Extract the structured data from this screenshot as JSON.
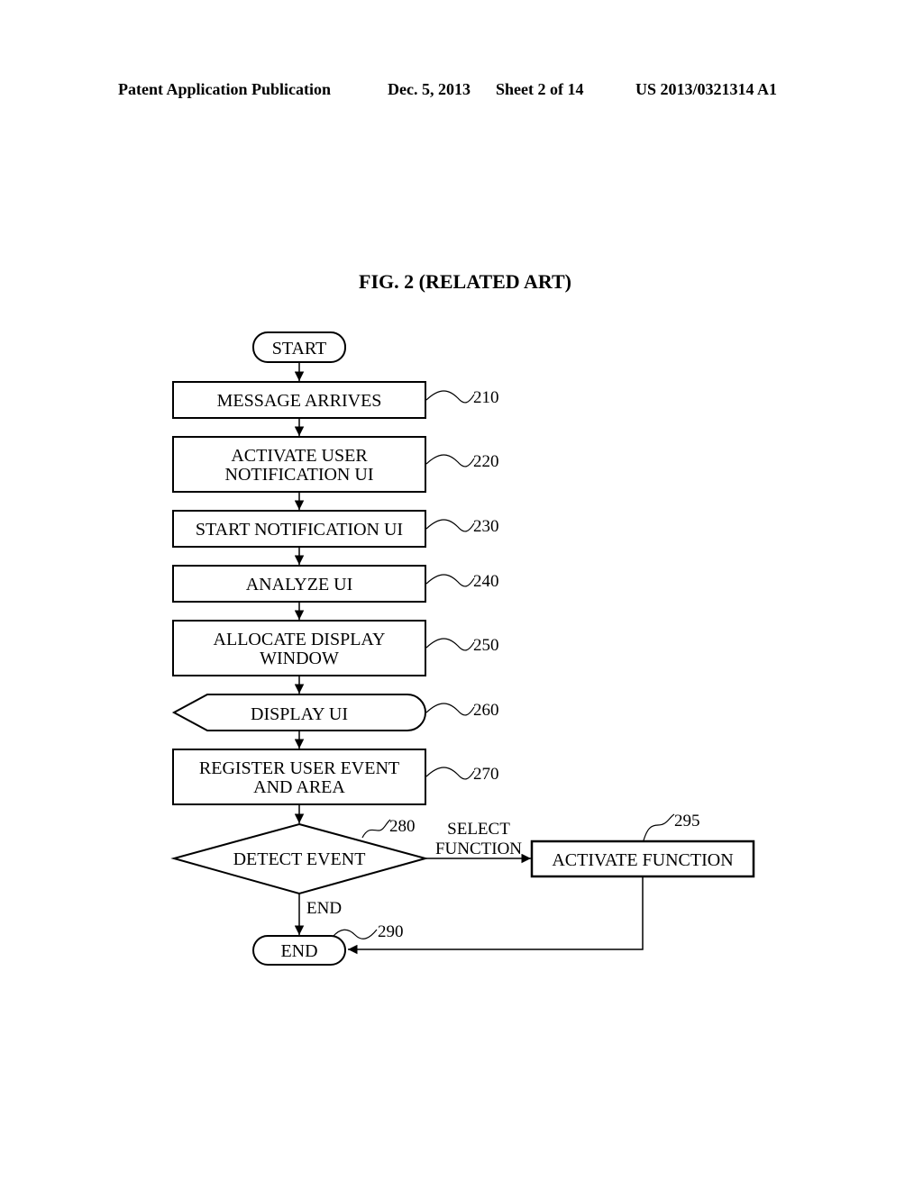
{
  "header": {
    "publication": "Patent Application Publication",
    "date": "Dec. 5, 2013",
    "sheet": "Sheet 2 of 14",
    "patent_number": "US 2013/0321314 A1"
  },
  "figure": {
    "title": "FIG. 2 (RELATED ART)"
  },
  "flowchart": {
    "start": {
      "label": "START"
    },
    "steps": [
      {
        "id": "210",
        "lines": [
          "MESSAGE ARRIVES"
        ],
        "shape": "process"
      },
      {
        "id": "220",
        "lines": [
          "ACTIVATE USER",
          "NOTIFICATION UI"
        ],
        "shape": "process"
      },
      {
        "id": "230",
        "lines": [
          "START NOTIFICATION UI"
        ],
        "shape": "process"
      },
      {
        "id": "240",
        "lines": [
          "ANALYZE UI"
        ],
        "shape": "process"
      },
      {
        "id": "250",
        "lines": [
          "ALLOCATE DISPLAY",
          "WINDOW"
        ],
        "shape": "process"
      },
      {
        "id": "260",
        "lines": [
          "DISPLAY UI"
        ],
        "shape": "display"
      },
      {
        "id": "270",
        "lines": [
          "REGISTER USER EVENT",
          "AND AREA"
        ],
        "shape": "process"
      }
    ],
    "decision": {
      "id": "280",
      "label": "DETECT EVENT"
    },
    "branch_select": {
      "lines": [
        "SELECT",
        "FUNCTION"
      ]
    },
    "branch_end": {
      "label": "END"
    },
    "activate": {
      "id": "295",
      "label": "ACTIVATE FUNCTION"
    },
    "end": {
      "id": "290",
      "label": "END"
    }
  }
}
